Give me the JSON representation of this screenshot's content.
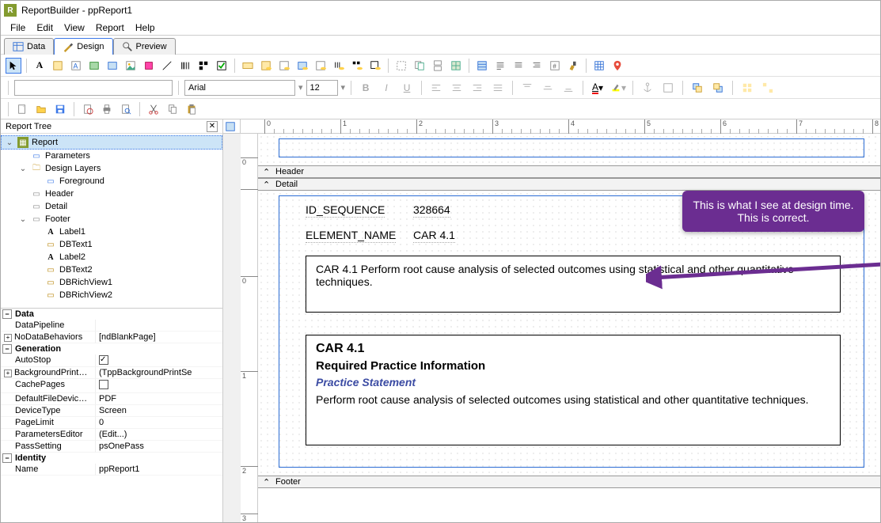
{
  "titlebar": {
    "app": "ReportBuilder",
    "doc": "ppReport1"
  },
  "menubar": [
    "File",
    "Edit",
    "View",
    "Report",
    "Help"
  ],
  "tabs": [
    {
      "label": "Data",
      "active": false
    },
    {
      "label": "Design",
      "active": true
    },
    {
      "label": "Preview",
      "active": false
    }
  ],
  "format": {
    "font": "Arial",
    "size": "12"
  },
  "report_tree": {
    "title": "Report Tree",
    "root": "Report",
    "items": [
      {
        "level": 1,
        "icon": "page",
        "label": "Parameters"
      },
      {
        "level": 1,
        "icon": "folder",
        "label": "Design Layers",
        "expand": "open"
      },
      {
        "level": 2,
        "icon": "page",
        "label": "Foreground"
      },
      {
        "level": 1,
        "icon": "band",
        "label": "Header"
      },
      {
        "level": 1,
        "icon": "band",
        "label": "Detail"
      },
      {
        "level": 1,
        "icon": "band",
        "label": "Footer",
        "expand": "open"
      },
      {
        "level": 2,
        "icon": "label",
        "label": "Label1"
      },
      {
        "level": 2,
        "icon": "field",
        "label": "DBText1"
      },
      {
        "level": 2,
        "icon": "label",
        "label": "Label2"
      },
      {
        "level": 2,
        "icon": "field",
        "label": "DBText2"
      },
      {
        "level": 2,
        "icon": "field",
        "label": "DBRichView1"
      },
      {
        "level": 2,
        "icon": "field",
        "label": "DBRichView2"
      }
    ]
  },
  "props": {
    "categories": [
      {
        "name": "Data",
        "rows": [
          {
            "name": "DataPipeline",
            "val": ""
          },
          {
            "name": "NoDataBehaviors",
            "val": "[ndBlankPage]",
            "expandable": true
          }
        ]
      },
      {
        "name": "Generation",
        "rows": [
          {
            "name": "AutoStop",
            "val": "",
            "check": true
          },
          {
            "name": "BackgroundPrintSettings",
            "val": "(TppBackgroundPrintSe",
            "expandable": true
          },
          {
            "name": "CachePages",
            "val": "",
            "check": false
          },
          {
            "name": "DefaultFileDeviceType",
            "val": "PDF"
          },
          {
            "name": "DeviceType",
            "val": "Screen"
          },
          {
            "name": "PageLimit",
            "val": "0"
          },
          {
            "name": "ParametersEditor",
            "val": "(Edit...)"
          },
          {
            "name": "PassSetting",
            "val": "psOnePass"
          }
        ]
      },
      {
        "name": "Identity",
        "rows": [
          {
            "name": "Name",
            "val": "ppReport1"
          }
        ]
      }
    ]
  },
  "bands": {
    "header": "Header",
    "detail": "Detail",
    "footer": "Footer"
  },
  "detail": {
    "id_seq_label": "ID_SEQUENCE",
    "id_seq_val": "328664",
    "elem_label": "ELEMENT_NAME",
    "elem_val": "CAR 4.1",
    "rich1": "CAR 4.1 Perform root cause analysis of selected outcomes using statistical and other quantitative techniques.",
    "rich2_h1": "CAR 4.1",
    "rich2_h2": "Required Practice Information",
    "rich2_ps": "Practice Statement",
    "rich2_body": "Perform root cause analysis of selected outcomes using statistical and other quantitative techniques."
  },
  "callout": "This is what I see at design time. This is correct.",
  "ruler_marks": [
    "0",
    "1",
    "2",
    "3",
    "4",
    "5",
    "6",
    "7",
    "8"
  ]
}
